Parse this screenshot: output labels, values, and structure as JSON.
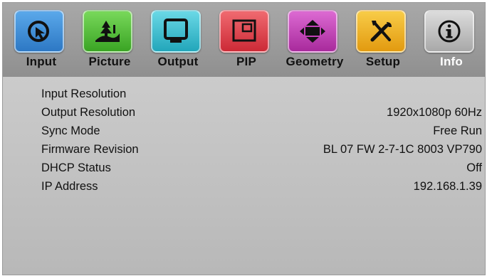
{
  "tabs": [
    {
      "label": "Input",
      "icon": "input-cursor-icon",
      "color": "#3b8fd6"
    },
    {
      "label": "Picture",
      "icon": "landscape-icon",
      "color": "#5cc23c"
    },
    {
      "label": "Output",
      "icon": "monitor-icon",
      "color": "#39c4d6"
    },
    {
      "label": "PIP",
      "icon": "pip-icon",
      "color": "#e4444e"
    },
    {
      "label": "Geometry",
      "icon": "geometry-icon",
      "color": "#c342b8"
    },
    {
      "label": "Setup",
      "icon": "tools-icon",
      "color": "#f2b41e"
    },
    {
      "label": "Info",
      "icon": "info-icon",
      "color": "#b8b8b8"
    }
  ],
  "active_tab": "Info",
  "info": [
    {
      "label": "Input Resolution",
      "value": ""
    },
    {
      "label": "Output Resolution",
      "value": "1920x1080p 60Hz"
    },
    {
      "label": "Sync Mode",
      "value": "Free Run"
    },
    {
      "label": "Firmware Revision",
      "value": "BL 07 FW 2-7-1C 8003 VP790"
    },
    {
      "label": "DHCP Status",
      "value": "Off"
    },
    {
      "label": "IP Address",
      "value": "192.168.1.39"
    }
  ]
}
